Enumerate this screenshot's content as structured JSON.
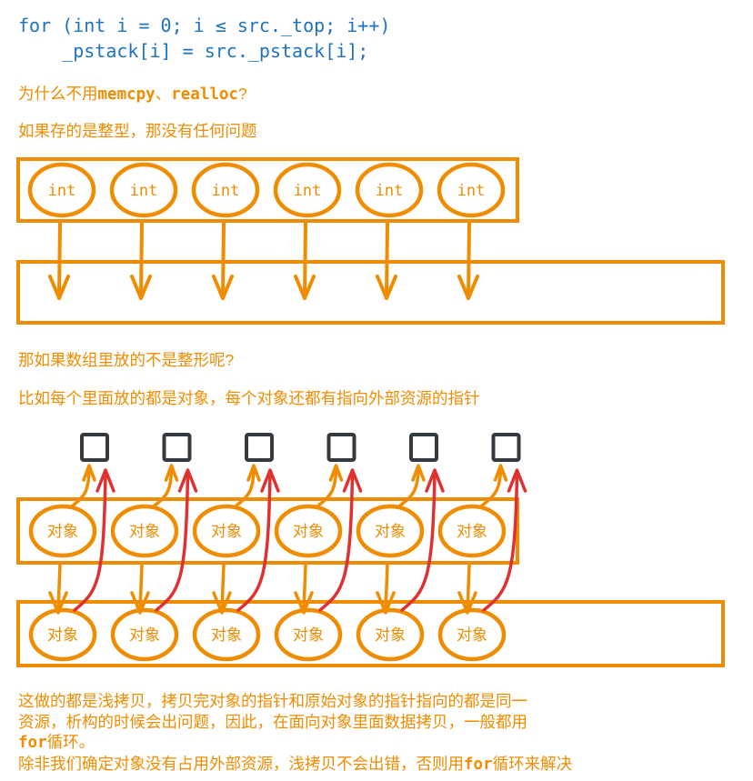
{
  "code": {
    "line1": "for (int i = 0; i ≤ src._top; i++)",
    "line2": "    _pstack[i] = src._pstack[i];"
  },
  "question1": {
    "prefix": "为什么不用",
    "code1": "memcpy",
    "sep": "、",
    "code2": "realloc",
    "suffix": "?"
  },
  "answer1": "如果存的是整型，那没有任何问题",
  "diagram1": {
    "element_label": "int",
    "element_count": 6,
    "colors": {
      "stroke": "#f08c00"
    }
  },
  "question2": "那如果数组里放的不是整形呢?",
  "answer2": "比如每个里面放的都是对象，每个对象还都有指向外部资源的指针",
  "diagram2": {
    "element_label": "对象",
    "element_count": 6,
    "colors": {
      "object": "#f08c00",
      "resource": "#343a40",
      "copied_pointer": "#e03131"
    }
  },
  "conclusion": {
    "line1": "这做的都是浅拷贝，拷贝完对象的指针和原始对象的指针指向的都是同一",
    "line2": "资源，析构的时候会出问题，因此，在面向对象里面数据拷贝，一般都用",
    "line3_code": "for",
    "line3_text": "循环。",
    "line4_prefix": "除非我们确定对象没有占用外部资源，浅拷贝不会出错，否则用",
    "line4_code": "for",
    "line4_suffix": "循环来解决"
  }
}
